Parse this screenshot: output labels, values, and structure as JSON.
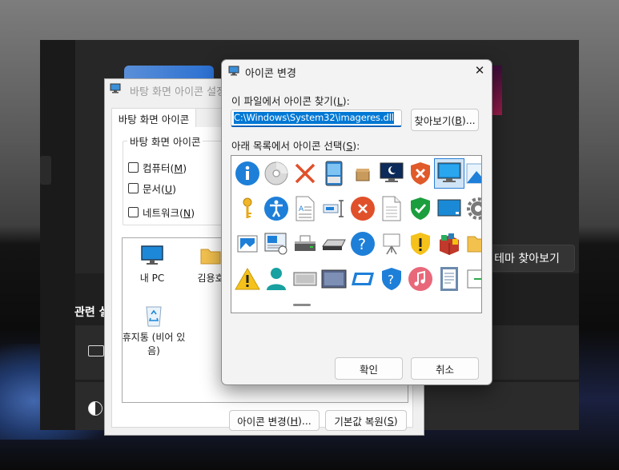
{
  "background": {
    "settings": {
      "browse_theme_button": "테마 찾아보기",
      "related_label": "관련 설"
    }
  },
  "desktop_icon_dialog": {
    "title": "바탕 화면 아이콘 설정",
    "tab": "바탕 화면 아이콘",
    "group_label": "바탕 화면 아이콘",
    "checkboxes": [
      {
        "label": "컴퓨터",
        "key": "M",
        "checked": false
      },
      {
        "label": "문서",
        "key": "U",
        "checked": false
      },
      {
        "label": "네트워크",
        "key": "N",
        "checked": false
      }
    ],
    "items": [
      {
        "label": "내 PC"
      },
      {
        "label": "김용호"
      },
      {
        "label": "휴지통 (비어 있음)"
      }
    ],
    "change_icon_button": "아이콘 변경",
    "change_icon_key": "H",
    "restore_button": "기본값 복원",
    "restore_key": "S"
  },
  "change_icon_dialog": {
    "title": "아이콘 변경",
    "find_label": "이 파일에서 아이콘 찾기",
    "find_key": "L",
    "path_value": "C:\\Windows\\System32\\imageres.dll",
    "browse_button": "찾아보기",
    "browse_key": "B",
    "select_label": "아래 목록에서 아이콘 선택",
    "select_key": "S",
    "ok_button": "확인",
    "cancel_button": "취소",
    "icons": [
      "info-icon",
      "cd-drive-icon",
      "error-x-icon",
      "tablet-icon",
      "package-icon",
      "screensaver-monitor-icon",
      "shield-x-icon",
      "monitor-icon",
      "image-landscape-icon",
      "key-icon",
      "accessibility-icon",
      "document-text-icon",
      "network-adapter-icon",
      "error-circle-icon",
      "document-icon",
      "shield-check-icon",
      "display-icon",
      "gear-icon",
      "picture-icon",
      "photo-viewer-icon",
      "scanner-icon",
      "scanner-flatbed-icon",
      "help-icon",
      "projector-icon",
      "shield-warning-icon",
      "programs-box-icon",
      "folder-icon",
      "warning-icon",
      "user-icon",
      "panel-icon",
      "monitor-frame-icon",
      "window-icon",
      "shield-help-icon",
      "music-icon",
      "document-lines-icon",
      "export-icon"
    ]
  }
}
